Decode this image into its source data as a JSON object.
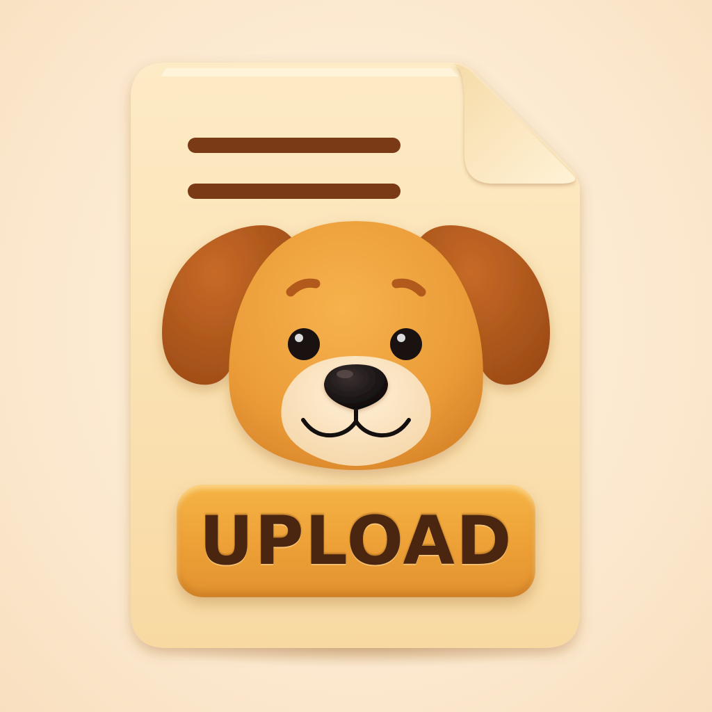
{
  "upload_button": {
    "label": "UPLOAD"
  },
  "icons": {
    "document": "document-icon",
    "mascot": "dog-face-icon"
  },
  "colors": {
    "background": "#fbe7cc",
    "document": "#fbe3b2",
    "document_fold": "#fdedc8",
    "text_lines": "#7a3a16",
    "dog_face": "#eea23e",
    "dog_ears": "#b2581c",
    "dog_muzzle": "#fbe6c4",
    "dog_nose": "#141010",
    "button": "#eda036",
    "button_text": "#4a2510"
  }
}
